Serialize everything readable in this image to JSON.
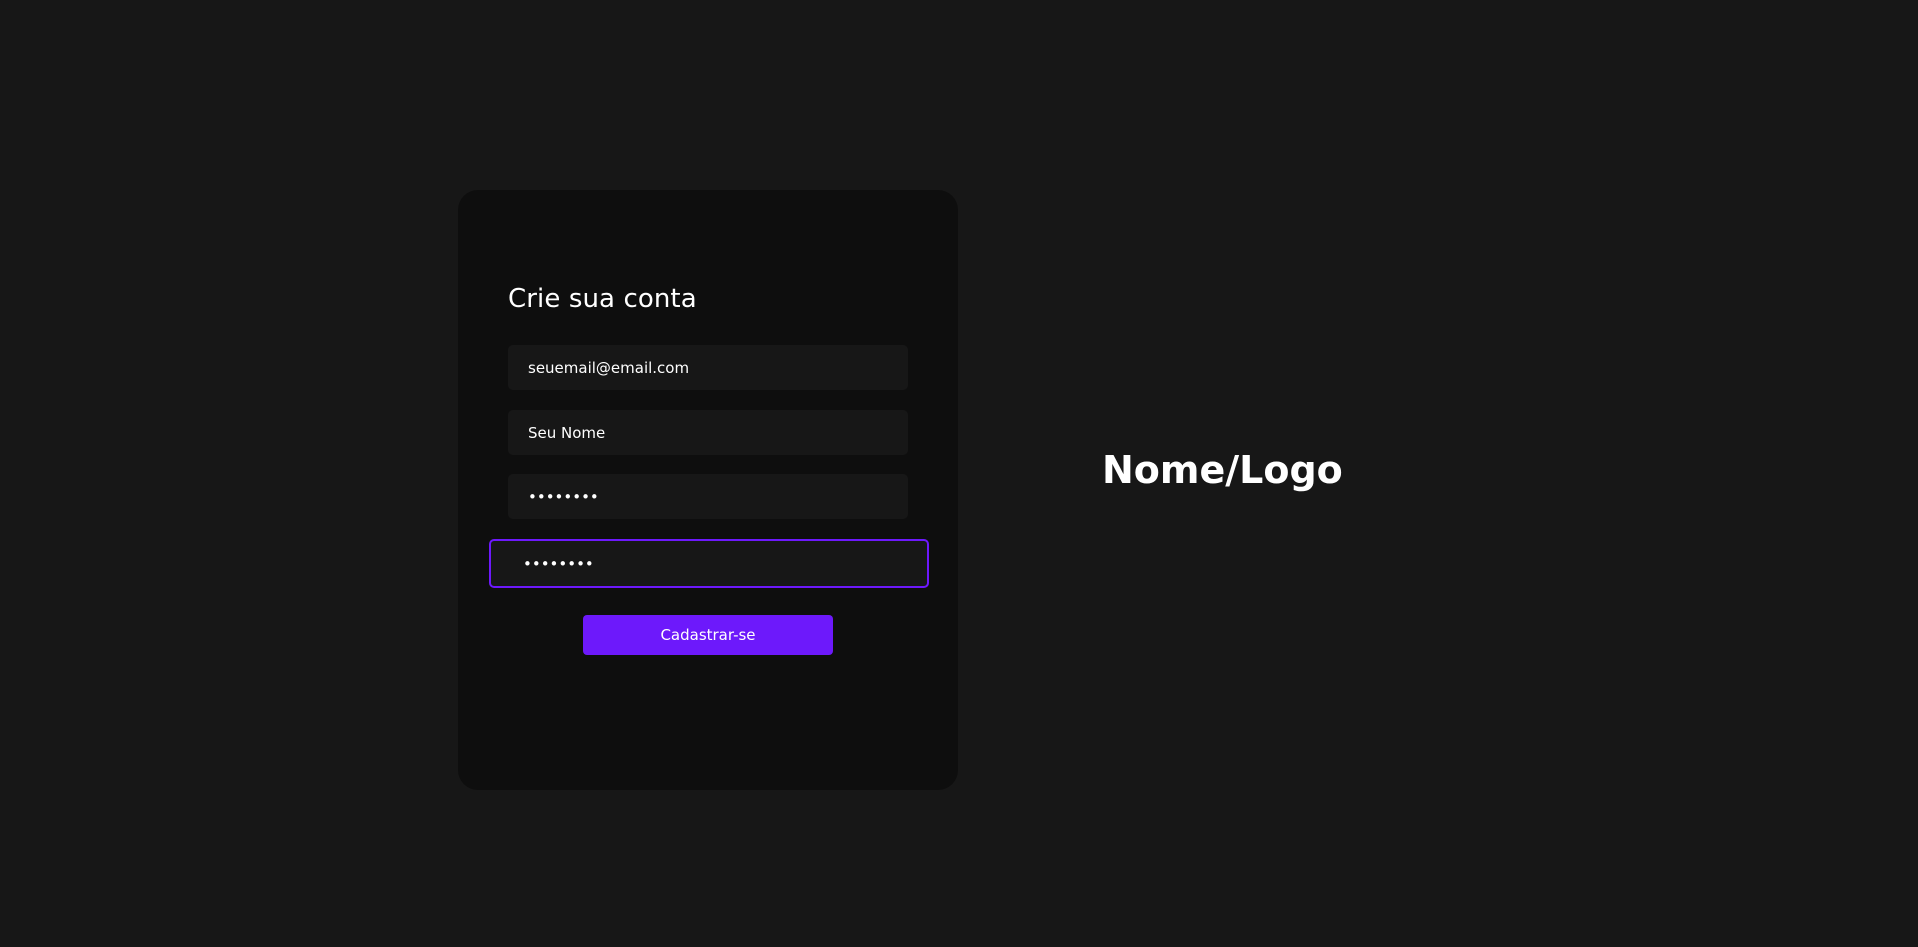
{
  "signup": {
    "title": "Crie sua conta",
    "email_value": "seuemail@email.com",
    "name_value": "Seu Nome",
    "password_value": "••••••••",
    "confirm_password_value": "••••••••",
    "submit_label": "Cadastrar-se"
  },
  "brand": {
    "label": "Nome/Logo"
  },
  "colors": {
    "background": "#171717",
    "card": "#0e0e0e",
    "input": "#171717",
    "accent": "#6d19fb",
    "text": "#ffffff"
  }
}
